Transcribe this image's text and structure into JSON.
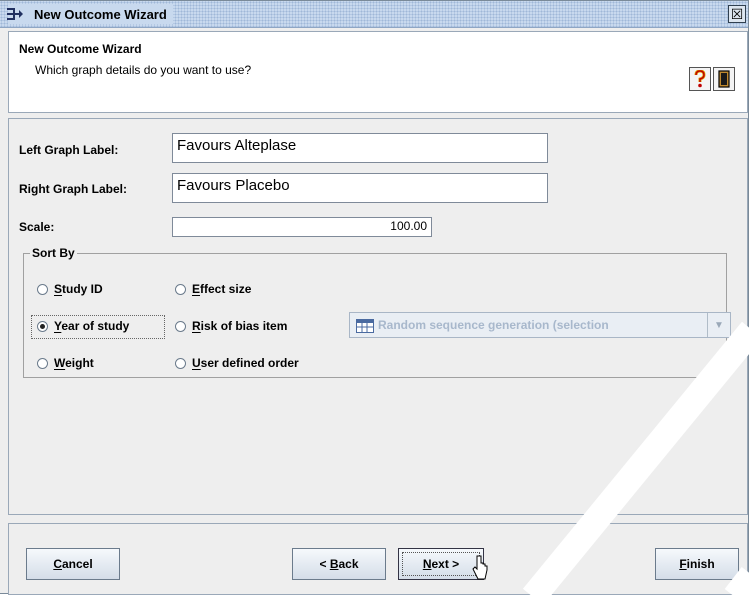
{
  "window": {
    "title": "New Outcome Wizard",
    "close_glyph": "☒"
  },
  "header": {
    "title": "New Outcome Wizard",
    "subtitle": "Which graph details do you want to use?",
    "help_icon": "question-mark-icon",
    "book_icon": "book-icon"
  },
  "form": {
    "left_label": "Left Graph Label:",
    "left_value": "Favours Alteplase",
    "right_label": "Right Graph Label:",
    "right_value": "Favours Placebo",
    "scale_label": "Scale:",
    "scale_value": "100.00"
  },
  "sort_by": {
    "legend": "Sort By",
    "options": {
      "study_id": {
        "mnemonic": "S",
        "rest": "tudy ID",
        "selected": false
      },
      "effect_size": {
        "mnemonic": "E",
        "rest": "ffect size",
        "selected": false
      },
      "year_of_study": {
        "mnemonic": "Y",
        "rest": "ear of study",
        "selected": true
      },
      "risk_of_bias": {
        "mnemonic": "R",
        "rest": "isk of bias item",
        "selected": false
      },
      "weight": {
        "mnemonic": "W",
        "rest": "eight",
        "selected": false
      },
      "user_defined": {
        "mnemonic": "U",
        "rest": "ser defined order",
        "selected": false
      }
    },
    "risk_combo": {
      "value": "Random sequence generation (selection",
      "enabled": false
    }
  },
  "buttons": {
    "cancel": {
      "mnemonic": "C",
      "rest": "ancel"
    },
    "back": {
      "prefix": "< ",
      "mnemonic": "B",
      "rest": "ack"
    },
    "next": {
      "mnemonic": "N",
      "rest": "ext >"
    },
    "finish": {
      "mnemonic": "F",
      "rest": "inish"
    }
  },
  "colors": {
    "title_bar": "#c8d9ee",
    "panel": "#eeeeee",
    "disabled_text": "#a8b8cc"
  }
}
